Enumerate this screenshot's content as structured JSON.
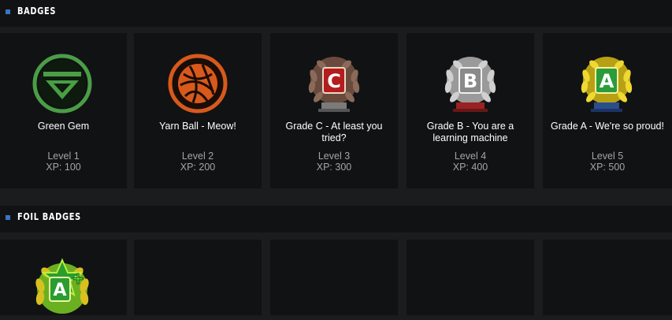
{
  "sections": {
    "badges": {
      "title": "BADGES",
      "accent": "#3b73c8"
    },
    "foil_badges": {
      "title": "FOIL BADGES",
      "accent": "#3b73c8"
    }
  },
  "badges": [
    {
      "name": "Green Gem",
      "level": "Level 1",
      "xp": "XP: 100",
      "icon": "green-gem-icon",
      "color": "#4caa4c"
    },
    {
      "name": "Yarn Ball - Meow!",
      "level": "Level 2",
      "xp": "XP: 200",
      "icon": "yarn-ball-icon",
      "color": "#e0601e"
    },
    {
      "name": "Grade C - At least you tried?",
      "level": "Level 3",
      "xp": "XP: 300",
      "icon": "grade-c-laurel-icon",
      "color": "#cc2222"
    },
    {
      "name": "Grade B - You are a learning machine",
      "level": "Level 4",
      "xp": "XP: 400",
      "icon": "grade-b-laurel-icon",
      "color": "#c8c8c8"
    },
    {
      "name": "Grade A - We're so proud!",
      "level": "Level 5",
      "xp": "XP: 500",
      "icon": "grade-a-laurel-icon",
      "color": "#e8d020"
    }
  ],
  "foil_badges": [
    {
      "icon": "grade-a-plus-foil-icon",
      "color": "#5dd43a"
    }
  ]
}
